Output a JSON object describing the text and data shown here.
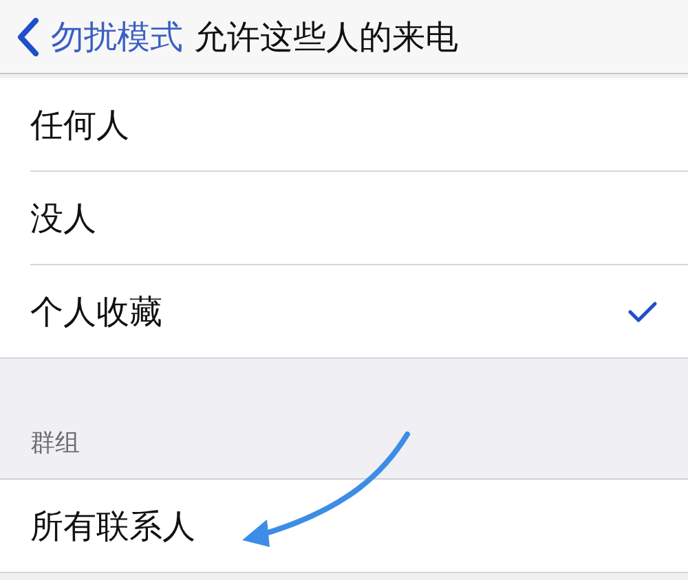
{
  "nav_bar": {
    "back_label": "勿扰模式",
    "title": "允许这些人的来电"
  },
  "options": [
    {
      "label": "任何人",
      "selected": false
    },
    {
      "label": "没人",
      "selected": false
    },
    {
      "label": "个人收藏",
      "selected": true
    }
  ],
  "groups": {
    "header": "群组",
    "items": [
      {
        "label": "所有联系人",
        "selected": false
      }
    ]
  }
}
